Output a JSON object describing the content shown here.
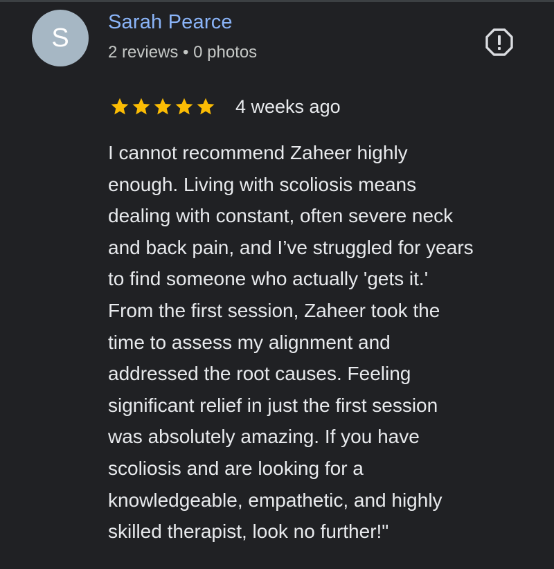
{
  "review": {
    "author": {
      "avatar_initial": "S",
      "avatar_color": "#a6b7c4",
      "name": "Sarah Pearce",
      "meta": "2 reviews • 0 photos"
    },
    "report_icon": "report-flag-icon",
    "rating": 5,
    "rating_max": 5,
    "star_color": "#fbbc04",
    "date": "4 weeks ago",
    "text": "I cannot recommend Zaheer highly\nenough. Living with scoliosis means\ndealing with constant, often severe neck\nand back pain, and I’ve struggled for years\nto find someone who actually 'gets it.'\nFrom the first session, Zaheer took the\ntime to assess my alignment and\naddressed the root causes. Feeling\nsignificant relief in just the first session\nwas absolutely amazing. If you have\nscoliosis and are looking for a\nknowledgeable, empathetic, and highly\nskilled therapist, look no further!\""
  },
  "theme": {
    "background": "#202124",
    "name_color": "#8ab4f8",
    "text_color": "#e8eaed"
  }
}
